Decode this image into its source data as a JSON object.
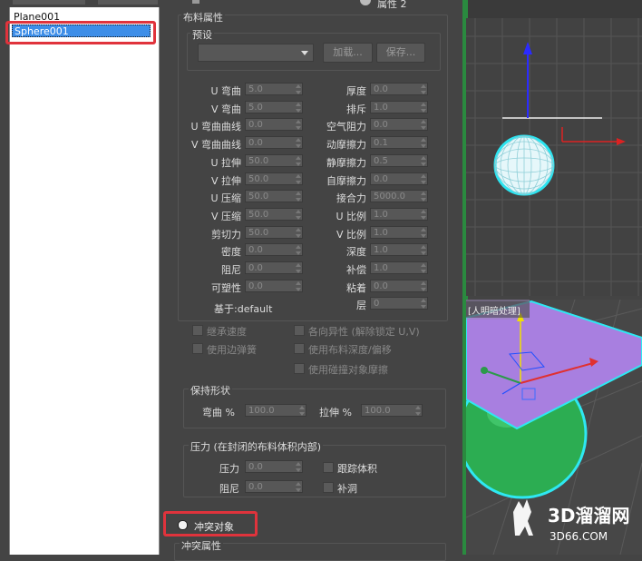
{
  "object_list": {
    "items": [
      "Plane001",
      "Sphere001"
    ],
    "selected_index": 1
  },
  "top_strip": {
    "radio_label": "属性 2"
  },
  "cloth_properties": {
    "title": "布料属性",
    "preset_label": "预设",
    "load_button": "加载...",
    "save_button": "保存...",
    "left_params": [
      {
        "label": "U 弯曲",
        "value": "5.0"
      },
      {
        "label": "V 弯曲",
        "value": "5.0"
      },
      {
        "label": "U 弯曲曲线",
        "value": "0.0"
      },
      {
        "label": "V 弯曲曲线",
        "value": "0.0"
      },
      {
        "label": "U 拉伸",
        "value": "50.0"
      },
      {
        "label": "V 拉伸",
        "value": "50.0"
      },
      {
        "label": "U 压缩",
        "value": "50.0"
      },
      {
        "label": "V 压缩",
        "value": "50.0"
      },
      {
        "label": "剪切力",
        "value": "50.0"
      },
      {
        "label": "密度",
        "value": "0.0"
      },
      {
        "label": "阻尼",
        "value": "0.0"
      },
      {
        "label": "可塑性",
        "value": "0.0"
      }
    ],
    "right_params": [
      {
        "label": "厚度",
        "value": "0.0"
      },
      {
        "label": "排斥",
        "value": "1.0"
      },
      {
        "label": "空气阻力",
        "value": "0.0"
      },
      {
        "label": "动摩擦力",
        "value": "0.1"
      },
      {
        "label": "静摩擦力",
        "value": "0.5"
      },
      {
        "label": "自摩擦力",
        "value": "0.0"
      },
      {
        "label": "接合力",
        "value": "5000.0"
      },
      {
        "label": "U 比例",
        "value": "1.0"
      },
      {
        "label": "V 比例",
        "value": "1.0"
      },
      {
        "label": "深度",
        "value": "1.0"
      },
      {
        "label": "补偿",
        "value": "1.0"
      },
      {
        "label": "粘着",
        "value": "0.0"
      },
      {
        "label": "层",
        "value": "0"
      }
    ],
    "based_on": "基于:default",
    "checks_left": [
      "继承速度",
      "使用边弹簧"
    ],
    "checks_right": [
      "各向异性 (解除锁定 U,V)",
      "使用布料深度/偏移",
      "使用碰撞对象摩擦"
    ]
  },
  "keep_shape": {
    "title": "保持形状",
    "bend_label": "弯曲 %",
    "bend_value": "100.0",
    "stretch_label": "拉伸 %",
    "stretch_value": "100.0"
  },
  "pressure": {
    "title": "压力 (在封闭的布料体积内部)",
    "pressure_label": "压力",
    "pressure_value": "0.0",
    "damping_label": "阻尼",
    "damping_value": "0.0",
    "track_volume": "跟踪体积",
    "cap_holes": "补洞"
  },
  "collision": {
    "radio_label": "冲突对象",
    "section_label": "冲突属性"
  },
  "viewport": {
    "label": "[人明暗处理]"
  },
  "watermark": {
    "name": "3D溜溜网",
    "url": "3D66.COM"
  }
}
